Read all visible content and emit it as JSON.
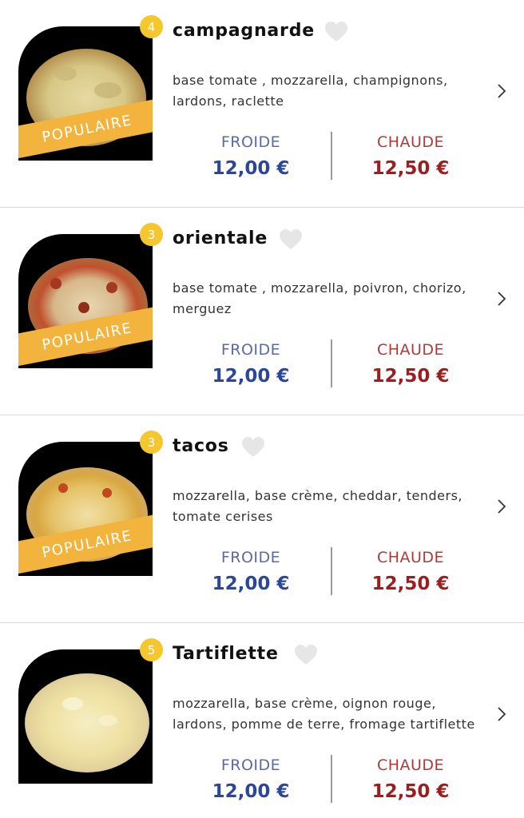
{
  "common": {
    "popular_label": "POPULAIRE",
    "froide_label": "FROIDE",
    "chaude_label": "CHAUDE"
  },
  "items": [
    {
      "badge": "4",
      "name": "campagnarde",
      "description": "base tomate , mozzarella, champignons, lardons, raclette",
      "price_froide": "12,00 €",
      "price_chaude": "12,50 €"
    },
    {
      "badge": "3",
      "name": "orientale",
      "description": "base tomate , mozzarella, poivron, chorizo, merguez",
      "price_froide": "12,00 €",
      "price_chaude": "12,50 €"
    },
    {
      "badge": "3",
      "name": "tacos",
      "description": "mozzarella, base crème, cheddar, tenders, tomate cerises",
      "price_froide": "12,00 €",
      "price_chaude": "12,50 €"
    },
    {
      "badge": "5",
      "name": "Tartiflette",
      "description": "mozzarella, base crème, oignon rouge, lardons, pomme de terre, fromage tartiflette",
      "price_froide": "12,00 €",
      "price_chaude": "12,50 €"
    }
  ]
}
